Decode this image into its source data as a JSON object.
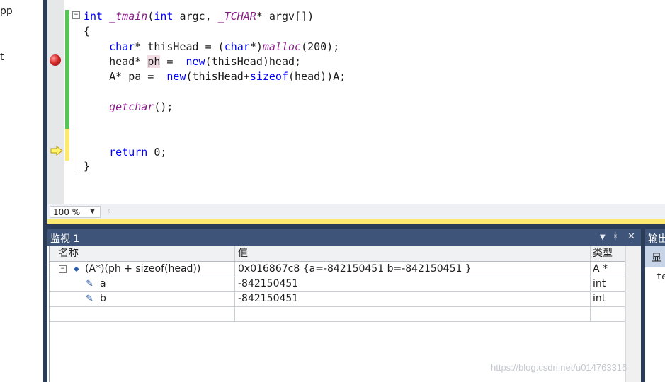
{
  "left_pane": {
    "fragments": [
      "pp",
      "t"
    ]
  },
  "editor": {
    "lines": [
      {
        "parts": [
          {
            "t": "int ",
            "c": "kw"
          },
          {
            "t": "_tmain",
            "c": "fn"
          },
          {
            "t": "(",
            "c": ""
          },
          {
            "t": "int",
            "c": "kw"
          },
          {
            "t": " argc, ",
            "c": ""
          },
          {
            "t": "_TCHAR",
            "c": "fn"
          },
          {
            "t": "* argv[])",
            "c": ""
          }
        ]
      },
      {
        "parts": [
          {
            "t": "{",
            "c": ""
          }
        ]
      },
      {
        "parts": [
          {
            "t": "    ",
            "c": ""
          },
          {
            "t": "char",
            "c": "kw"
          },
          {
            "t": "* thisHead = (",
            "c": ""
          },
          {
            "t": "char",
            "c": "kw"
          },
          {
            "t": "*)",
            "c": ""
          },
          {
            "t": "malloc",
            "c": "fn"
          },
          {
            "t": "(200);",
            "c": ""
          }
        ]
      },
      {
        "parts": [
          {
            "t": "    head* ",
            "c": ""
          },
          {
            "t": "ph",
            "c": "hl"
          },
          {
            "t": " =  ",
            "c": ""
          },
          {
            "t": "new",
            "c": "kw"
          },
          {
            "t": "(thisHead)head;",
            "c": ""
          }
        ]
      },
      {
        "parts": [
          {
            "t": "    A* pa =  ",
            "c": ""
          },
          {
            "t": "new",
            "c": "kw"
          },
          {
            "t": "(thisHead+",
            "c": ""
          },
          {
            "t": "sizeof",
            "c": "kw"
          },
          {
            "t": "(head))A;",
            "c": ""
          }
        ]
      },
      {
        "parts": [
          {
            "t": "    ",
            "c": ""
          },
          {
            "t": "getchar",
            "c": "fn"
          },
          {
            "t": "();",
            "c": ""
          }
        ]
      },
      {
        "parts": [
          {
            "t": "    ",
            "c": ""
          },
          {
            "t": "return",
            "c": "kw"
          },
          {
            "t": " 0;",
            "c": ""
          }
        ]
      },
      {
        "parts": [
          {
            "t": "}",
            "c": ""
          }
        ]
      }
    ],
    "fold_symbol": "−"
  },
  "zoom": {
    "value": "100 %",
    "arrow": "▼",
    "scroll_left": "‹"
  },
  "watch": {
    "title": "监视 1",
    "controls": {
      "dropdown": "▼",
      "pin": "ᚼ",
      "close": "✕"
    },
    "columns": {
      "name": "名称",
      "value": "值",
      "type": "类型"
    },
    "rows": [
      {
        "expand": "−",
        "icon": "◆",
        "name": "(A*)(ph + sizeof(head))",
        "value": "0x016867c8 {a=-842150451 b=-842150451 }",
        "type": "A *"
      },
      {
        "expand": "",
        "icon": "✎",
        "name": "a",
        "value": "-842150451",
        "type": "int"
      },
      {
        "expand": "",
        "icon": "✎",
        "name": "b",
        "value": "-842150451",
        "type": "int"
      }
    ]
  },
  "output": {
    "title": "输出",
    "tab": "显",
    "text": "te"
  },
  "watermark": "https://blog.csdn.net/u014763316"
}
